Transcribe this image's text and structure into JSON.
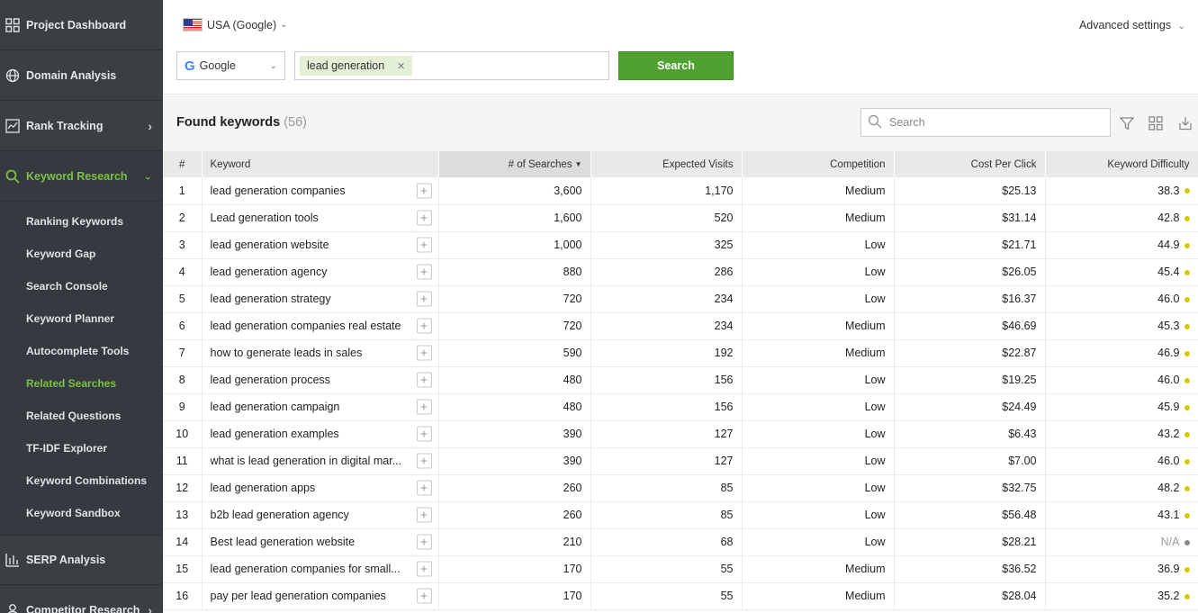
{
  "sidebar": {
    "items": [
      {
        "label": "Project Dashboard",
        "icon": "dashboard-icon"
      },
      {
        "label": "Domain Analysis",
        "icon": "globe-icon"
      },
      {
        "label": "Rank Tracking",
        "icon": "chart-line-icon"
      },
      {
        "label": "Keyword Research",
        "icon": "search-icon"
      }
    ],
    "sub_items": [
      {
        "label": "Ranking Keywords"
      },
      {
        "label": "Keyword Gap"
      },
      {
        "label": "Search Console"
      },
      {
        "label": "Keyword Planner"
      },
      {
        "label": "Autocomplete Tools"
      },
      {
        "label": "Related Searches",
        "active": true
      },
      {
        "label": "Related Questions"
      },
      {
        "label": "TF-IDF Explorer"
      },
      {
        "label": "Keyword Combinations"
      },
      {
        "label": "Keyword Sandbox"
      }
    ],
    "bottom_items": [
      {
        "label": "SERP Analysis",
        "icon": "bar-chart-icon"
      },
      {
        "label": "Competitor Research",
        "icon": "user-icon"
      }
    ],
    "accent_color": "#7cc142"
  },
  "topbar": {
    "region": "USA (Google)",
    "advanced_settings": "Advanced settings",
    "engine": "Google",
    "query_tag": "lead generation",
    "search_button": "Search"
  },
  "found": {
    "title": "Found keywords",
    "count": "(56)",
    "search_placeholder": "Search"
  },
  "table": {
    "headers": [
      "#",
      "Keyword",
      "# of Searches",
      "Expected Visits",
      "Competition",
      "Cost Per Click",
      "Keyword Difficulty"
    ],
    "rows": [
      {
        "idx": "1",
        "keyword": "lead generation companies",
        "searches": "3,600",
        "visits": "1,170",
        "competition": "Medium",
        "cpc": "$25.13",
        "difficulty": "38.3",
        "dot": "#d4c800"
      },
      {
        "idx": "2",
        "keyword": "Lead generation tools",
        "searches": "1,600",
        "visits": "520",
        "competition": "Medium",
        "cpc": "$31.14",
        "difficulty": "42.8",
        "dot": "#d4c800"
      },
      {
        "idx": "3",
        "keyword": "lead generation website",
        "searches": "1,000",
        "visits": "325",
        "competition": "Low",
        "cpc": "$21.71",
        "difficulty": "44.9",
        "dot": "#d4c800"
      },
      {
        "idx": "4",
        "keyword": "lead generation agency",
        "searches": "880",
        "visits": "286",
        "competition": "Low",
        "cpc": "$26.05",
        "difficulty": "45.4",
        "dot": "#d4c800"
      },
      {
        "idx": "5",
        "keyword": "lead generation strategy",
        "searches": "720",
        "visits": "234",
        "competition": "Low",
        "cpc": "$16.37",
        "difficulty": "46.0",
        "dot": "#d4c800"
      },
      {
        "idx": "6",
        "keyword": "lead generation companies real estate",
        "searches": "720",
        "visits": "234",
        "competition": "Medium",
        "cpc": "$46.69",
        "difficulty": "45.3",
        "dot": "#d4c800"
      },
      {
        "idx": "7",
        "keyword": "how to generate leads in sales",
        "searches": "590",
        "visits": "192",
        "competition": "Medium",
        "cpc": "$22.87",
        "difficulty": "46.9",
        "dot": "#d4c800"
      },
      {
        "idx": "8",
        "keyword": "lead generation process",
        "searches": "480",
        "visits": "156",
        "competition": "Low",
        "cpc": "$19.25",
        "difficulty": "46.0",
        "dot": "#d4c800"
      },
      {
        "idx": "9",
        "keyword": "lead generation campaign",
        "searches": "480",
        "visits": "156",
        "competition": "Low",
        "cpc": "$24.49",
        "difficulty": "45.9",
        "dot": "#d4c800"
      },
      {
        "idx": "10",
        "keyword": "lead generation examples",
        "searches": "390",
        "visits": "127",
        "competition": "Low",
        "cpc": "$6.43",
        "difficulty": "43.2",
        "dot": "#d4c800"
      },
      {
        "idx": "11",
        "keyword": "what is lead generation in digital mar...",
        "searches": "390",
        "visits": "127",
        "competition": "Low",
        "cpc": "$7.00",
        "difficulty": "46.0",
        "dot": "#d4c800"
      },
      {
        "idx": "12",
        "keyword": "lead generation apps",
        "searches": "260",
        "visits": "85",
        "competition": "Low",
        "cpc": "$32.75",
        "difficulty": "48.2",
        "dot": "#d4c800"
      },
      {
        "idx": "13",
        "keyword": "b2b lead generation agency",
        "searches": "260",
        "visits": "85",
        "competition": "Low",
        "cpc": "$56.48",
        "difficulty": "43.1",
        "dot": "#d4c800"
      },
      {
        "idx": "14",
        "keyword": "Best lead generation website",
        "searches": "210",
        "visits": "68",
        "competition": "Low",
        "cpc": "$28.21",
        "difficulty": "N/A",
        "dot": "#8a8a8a"
      },
      {
        "idx": "15",
        "keyword": "lead generation companies for small...",
        "searches": "170",
        "visits": "55",
        "competition": "Medium",
        "cpc": "$36.52",
        "difficulty": "36.9",
        "dot": "#d4c800"
      },
      {
        "idx": "16",
        "keyword": "pay per lead generation companies",
        "searches": "170",
        "visits": "55",
        "competition": "Medium",
        "cpc": "$28.04",
        "difficulty": "35.2",
        "dot": "#d4c800"
      }
    ]
  }
}
